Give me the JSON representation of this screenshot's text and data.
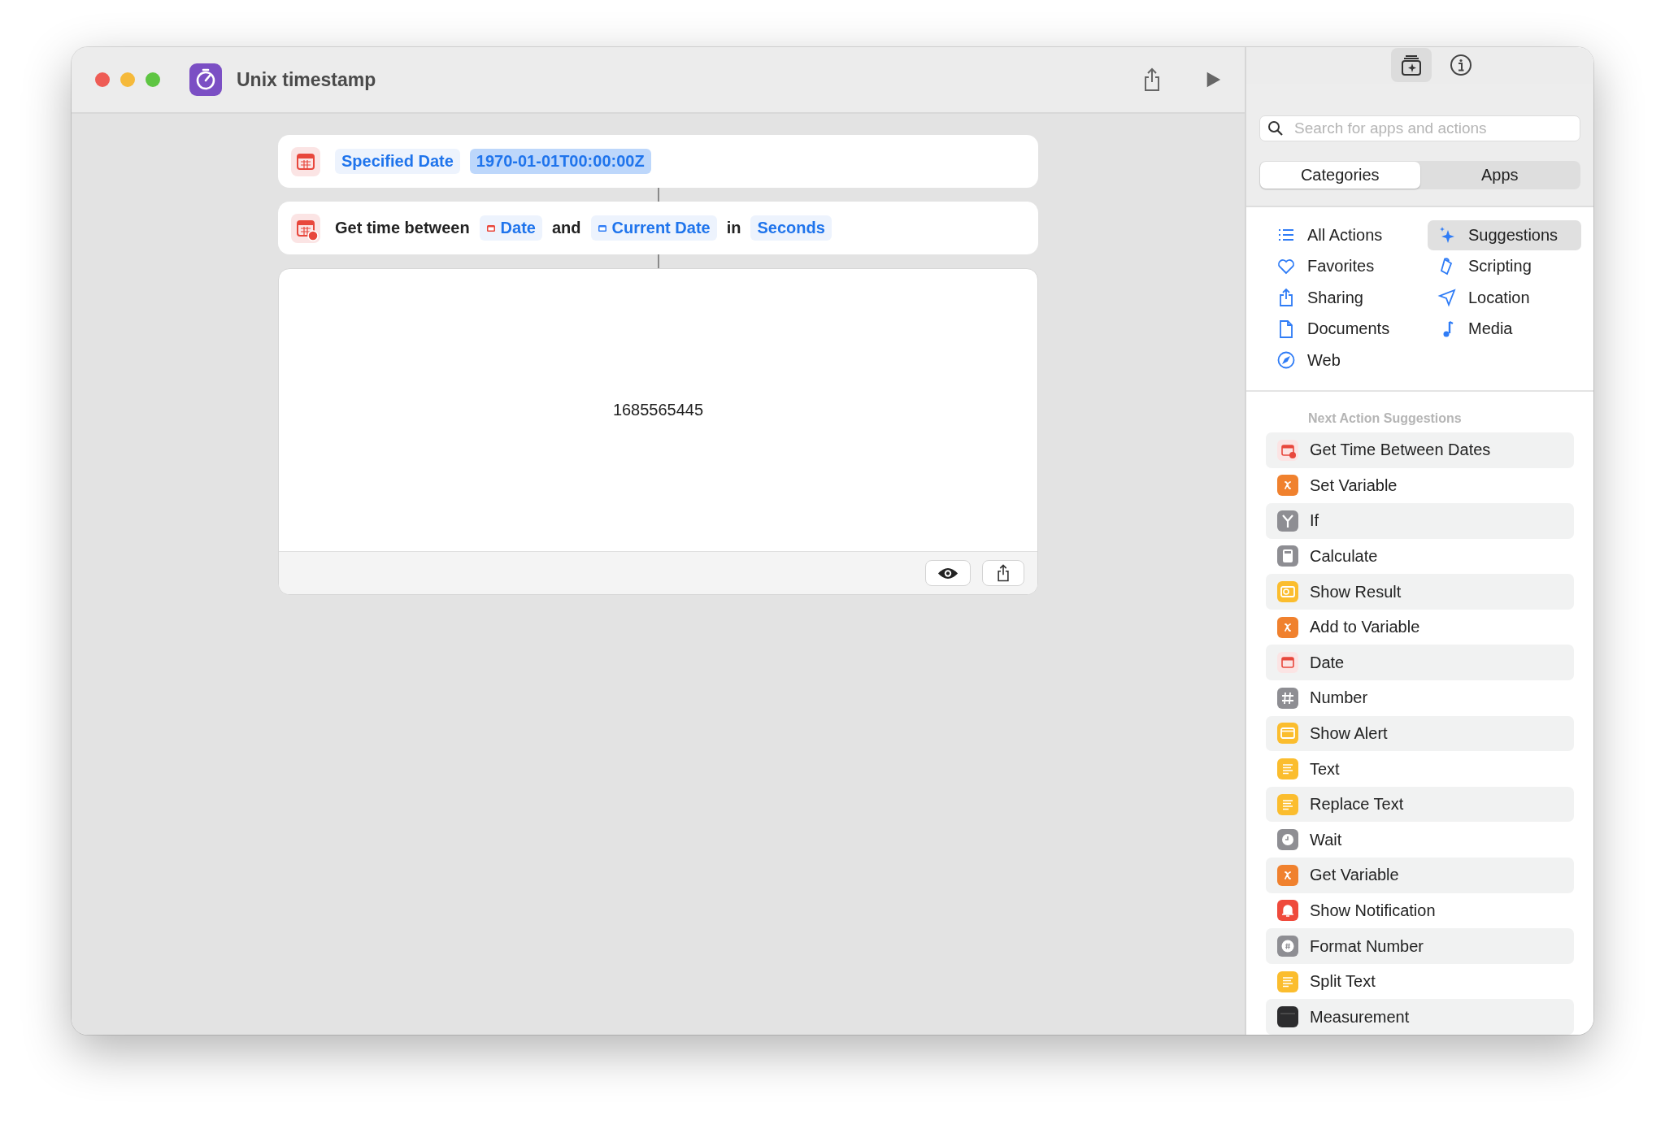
{
  "window": {
    "title": "Unix timestamp"
  },
  "actions": [
    {
      "parts": [
        {
          "kind": "token",
          "text": "Specified Date"
        },
        {
          "kind": "value",
          "text": "1970-01-01T00:00:00Z"
        }
      ]
    },
    {
      "parts": [
        {
          "kind": "text",
          "text": "Get time between"
        },
        {
          "kind": "variable",
          "text": "Date"
        },
        {
          "kind": "text",
          "text": "and"
        },
        {
          "kind": "variable",
          "text": "Current Date"
        },
        {
          "kind": "text",
          "text": "in"
        },
        {
          "kind": "token",
          "text": "Seconds"
        }
      ]
    }
  ],
  "result": {
    "value": "1685565445"
  },
  "sidebar": {
    "search": {
      "placeholder": "Search for apps and actions"
    },
    "tabs": [
      {
        "label": "Categories",
        "selected": true
      },
      {
        "label": "Apps",
        "selected": false
      }
    ],
    "categories": [
      {
        "label": "All Actions",
        "selected": false
      },
      {
        "label": "Favorites",
        "selected": false
      },
      {
        "label": "Sharing",
        "selected": false
      },
      {
        "label": "Documents",
        "selected": false
      },
      {
        "label": "Web",
        "selected": false
      },
      {
        "label": "Suggestions",
        "selected": true
      },
      {
        "label": "Scripting",
        "selected": false
      },
      {
        "label": "Location",
        "selected": false
      },
      {
        "label": "Media",
        "selected": false
      }
    ],
    "suggestions_title": "Next Action Suggestions",
    "suggestions": [
      {
        "label": "Get Time Between Dates",
        "kind": "calendar-clock",
        "color": "#fbe4e4"
      },
      {
        "label": "Set Variable",
        "kind": "variable",
        "color": "#f0812e"
      },
      {
        "label": "If",
        "kind": "branch",
        "color": "#8e8e93"
      },
      {
        "label": "Calculate",
        "kind": "calculator",
        "color": "#8e8e93"
      },
      {
        "label": "Show Result",
        "kind": "result",
        "color": "#fbbd2e"
      },
      {
        "label": "Add to Variable",
        "kind": "variable",
        "color": "#f0812e"
      },
      {
        "label": "Date",
        "kind": "calendar",
        "color": "#fbe4e4"
      },
      {
        "label": "Number",
        "kind": "hash",
        "color": "#8e8e93"
      },
      {
        "label": "Show Alert",
        "kind": "alert",
        "color": "#fbbd2e"
      },
      {
        "label": "Text",
        "kind": "text",
        "color": "#fbbd2e"
      },
      {
        "label": "Replace Text",
        "kind": "text",
        "color": "#fbbd2e"
      },
      {
        "label": "Wait",
        "kind": "clock",
        "color": "#8e8e93"
      },
      {
        "label": "Get Variable",
        "kind": "variable",
        "color": "#f0812e"
      },
      {
        "label": "Show Notification",
        "kind": "bell",
        "color": "#ef4a3c"
      },
      {
        "label": "Format Number",
        "kind": "format-number",
        "color": "#8e8e93"
      },
      {
        "label": "Split Text",
        "kind": "text",
        "color": "#fbbd2e"
      },
      {
        "label": "Measurement",
        "kind": "ruler",
        "color": "#2c2c2e"
      }
    ]
  }
}
